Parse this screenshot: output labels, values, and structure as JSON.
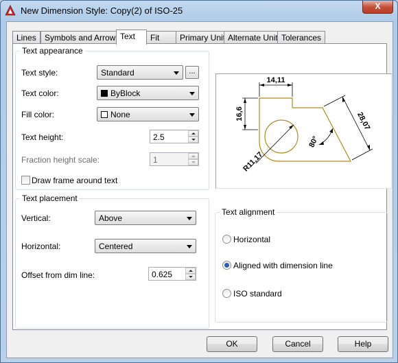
{
  "window": {
    "title": "New Dimension Style: Copy(2) of ISO-25",
    "close_glyph": "X"
  },
  "tabs": [
    "Lines",
    "Symbols and Arrows",
    "Text",
    "Fit",
    "Primary Units",
    "Alternate Units",
    "Tolerances"
  ],
  "active_tab": "Text",
  "text_appearance": {
    "group_title": "Text appearance",
    "text_style_label": "Text style:",
    "text_style_value": "Standard",
    "browse_label": "...",
    "text_color_label": "Text color:",
    "text_color_value": "ByBlock",
    "fill_color_label": "Fill color:",
    "fill_color_value": "None",
    "text_height_label": "Text height:",
    "text_height_value": "2.5",
    "fraction_label": "Fraction height scale:",
    "fraction_value": "1",
    "draw_frame_label": "Draw frame around text"
  },
  "text_placement": {
    "group_title": "Text placement",
    "vertical_label": "Vertical:",
    "vertical_value": "Above",
    "horizontal_label": "Horizontal:",
    "horizontal_value": "Centered",
    "offset_label": "Offset from dim line:",
    "offset_value": "0.625"
  },
  "text_alignment": {
    "group_title": "Text alignment",
    "options": [
      "Horizontal",
      "Aligned with dimension line",
      "ISO standard"
    ],
    "selected": "Aligned with dimension line"
  },
  "preview": {
    "dim_top": "14,11",
    "dim_left": "16,6",
    "dim_right": "28,07",
    "dim_angle": "80°",
    "dim_radius": "R11,17"
  },
  "footer": {
    "ok": "OK",
    "cancel": "Cancel",
    "help": "Help"
  },
  "colors": {
    "accent": "#2a5fae",
    "geometry": "#b08a1e"
  }
}
